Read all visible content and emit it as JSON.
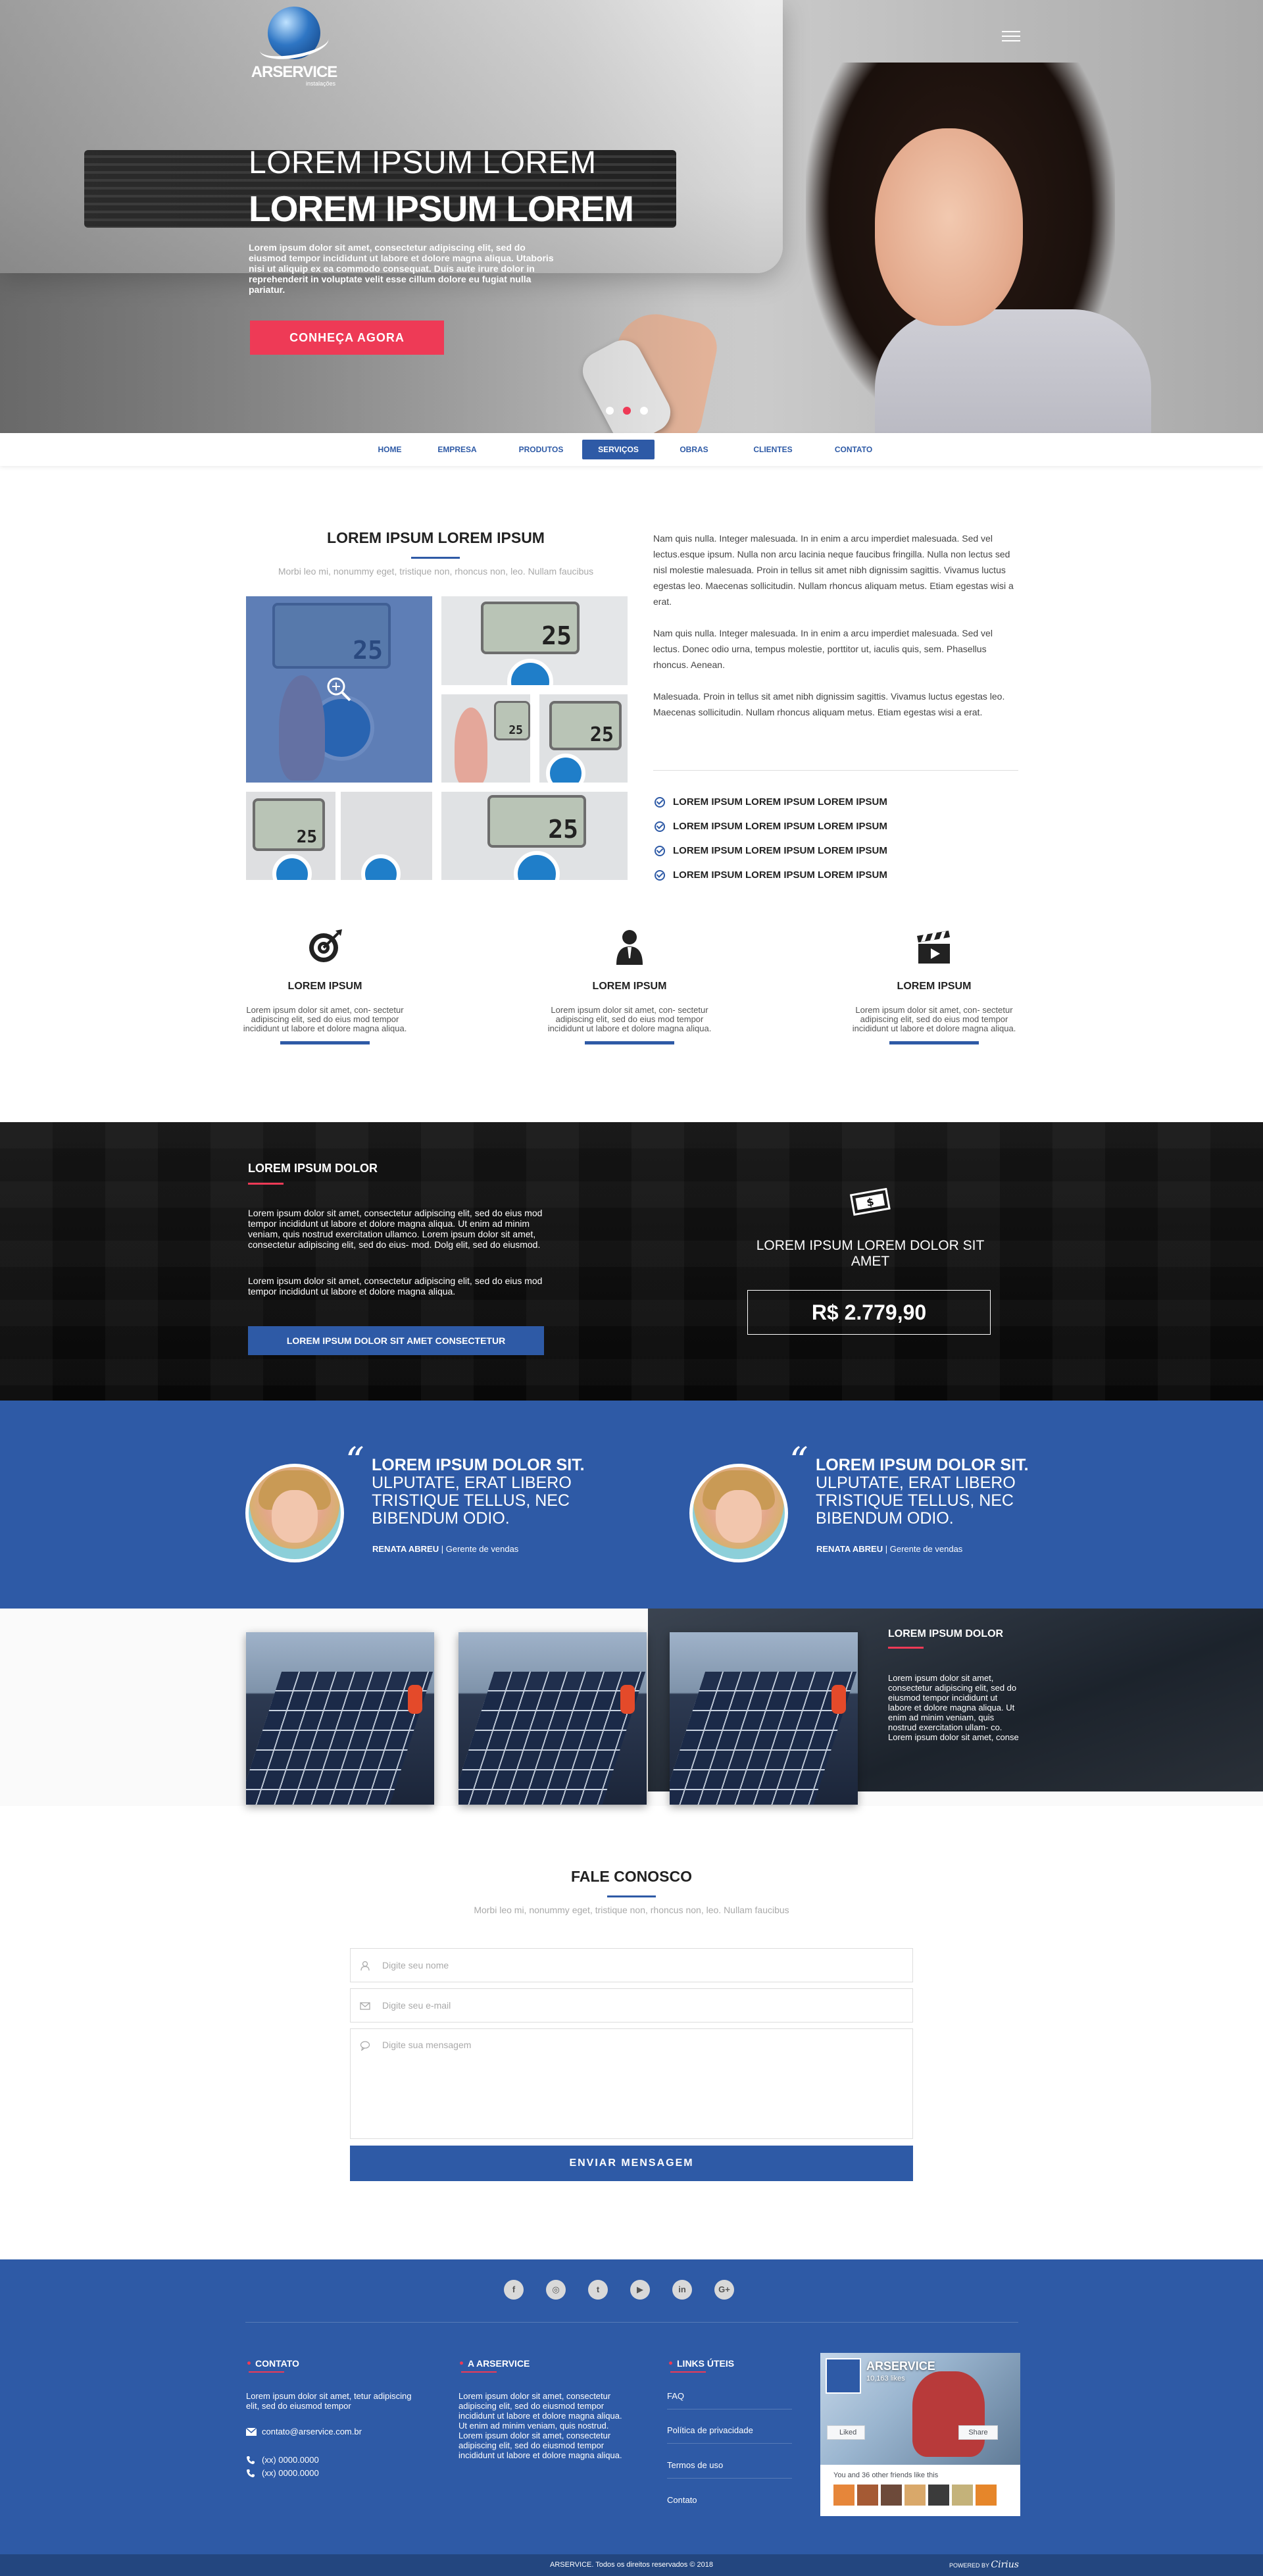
{
  "brand": {
    "name": "ARSERVICE",
    "tagline": "instalações"
  },
  "hero": {
    "line1": "LOREM IPSUM LOREM",
    "line2": "LOREM IPSUM LOREM",
    "paragraph": "Lorem ipsum dolor sit amet, consectetur adipiscing elit, sed do eiusmod tempor incididunt ut labore et dolore magna aliqua. Utaboris nisi ut aliquip ex ea commodo consequat. Duis aute irure dolor in reprehenderit in voluptate velit esse cillum dolore eu fugiat nulla pariatur.",
    "cta": "CONHEÇA AGORA",
    "slides": 3,
    "active_slide": 2
  },
  "nav": {
    "items": [
      "HOME",
      "EMPRESA",
      "PRODUTOS",
      "SERVIÇOS",
      "OBRAS",
      "CLIENTES",
      "CONTATO"
    ],
    "active": "SERVIÇOS"
  },
  "about": {
    "title": "LOREM IPSUM LOREM IPSUM",
    "subtitle": "Morbi leo mi, nonummy eget, tristique non, rhoncus non, leo. Nullam faucibus",
    "gallery_readouts": [
      "25",
      "25",
      "25",
      "25",
      "25",
      "25"
    ],
    "paragraphs": [
      "Nam quis nulla. Integer malesuada. In in enim a arcu imperdiet malesuada. Sed vel lectus.esque ipsum. Nulla non arcu lacinia neque faucibus fringilla. Nulla non lectus sed nisl molestie malesuada. Proin in tellus sit amet nibh dignissim sagittis. Vivamus luctus egestas leo. Maecenas sollicitudin. Nullam rhoncus aliquam metus. Etiam egestas wisi a erat.",
      "Nam quis nulla. Integer malesuada. In in enim a arcu imperdiet malesuada. Sed vel lectus. Donec odio urna, tempus molestie, porttitor ut, iaculis quis, sem. Phasellus rhoncus. Aenean.",
      "Malesuada. Proin in tellus sit amet nibh dignissim sagittis. Vivamus luctus egestas leo. Maecenas sollicitudin. Nullam rhoncus aliquam metus. Etiam egestas wisi a erat."
    ],
    "checklist": [
      "LOREM IPSUM LOREM IPSUM LOREM IPSUM",
      "LOREM IPSUM LOREM IPSUM LOREM IPSUM",
      "LOREM IPSUM LOREM IPSUM LOREM IPSUM",
      "LOREM IPSUM LOREM IPSUM LOREM IPSUM"
    ]
  },
  "features": [
    {
      "icon": "target-icon",
      "title": "LOREM IPSUM",
      "text": "Lorem ipsum dolor sit amet, con- sectetur adipiscing elit, sed do eius mod tempor incididunt ut labore et dolore magna aliqua."
    },
    {
      "icon": "businessman-icon",
      "title": "LOREM IPSUM",
      "text": "Lorem ipsum dolor sit amet, con- sectetur adipiscing elit, sed do eius mod tempor incididunt ut labore et dolore magna aliqua."
    },
    {
      "icon": "clapperboard-icon",
      "title": "LOREM IPSUM",
      "text": "Lorem ipsum dolor sit amet, con- sectetur adipiscing elit, sed do eius mod tempor incididunt ut labore et dolore magna aliqua."
    }
  ],
  "pricing": {
    "title": "LOREM IPSUM DOLOR",
    "p1": "Lorem ipsum dolor sit amet, consectetur adipiscing elit, sed do eius mod tempor incididunt ut labore et dolore magna aliqua. Ut enim ad minim veniam, quis nostrud exercitation ullamco. Lorem ipsum dolor sit amet, consectetur adipiscing elit, sed do eius- mod. Dolg elit, sed do eiusmod.",
    "p2": "Lorem ipsum dolor sit amet, consectetur adipiscing elit, sed do eius mod tempor incididunt ut labore et dolore magna aliqua.",
    "button": "LOREM IPSUM DOLOR SIT AMET CONSECTETUR",
    "price_title": "LOREM IPSUM LOREM DOLOR SIT AMET",
    "price": "R$ 2.779,90"
  },
  "testimonials": [
    {
      "quote_bold": "LOREM IPSUM DOLOR SIT.",
      "quote": "ULPUTATE, ERAT LIBERO TRISTIQUE TELLUS, NEC BIBENDUM ODIO.",
      "author": "RENATA ABREU",
      "role": "| Gerente de vendas"
    },
    {
      "quote_bold": "LOREM IPSUM DOLOR SIT.",
      "quote": "ULPUTATE, ERAT LIBERO TRISTIQUE TELLUS, NEC BIBENDUM ODIO.",
      "author": "RENATA ABREU",
      "role": "| Gerente de vendas"
    }
  ],
  "projects": {
    "title": "LOREM IPSUM DOLOR",
    "text": "Lorem ipsum dolor sit amet, consectetur adipiscing elit, sed do eiusmod tempor incididunt ut labore et dolore magna aliqua. Ut enim ad minim veniam, quis nostrud exercitation ullam- co. Lorem ipsum dolor sit amet, conse"
  },
  "contact": {
    "title": "FALE CONOSCO",
    "subtitle": "Morbi leo mi, nonummy eget, tristique non, rhoncus non, leo. Nullam faucibus",
    "name_placeholder": "Digite seu nome",
    "email_placeholder": "Digite seu e-mail",
    "message_placeholder": "Digite sua mensagem",
    "submit": "ENVIAR MENSAGEM"
  },
  "footer": {
    "social": [
      {
        "icon": "facebook-icon",
        "glyph": "f"
      },
      {
        "icon": "instagram-icon",
        "glyph": "◎"
      },
      {
        "icon": "twitter-icon",
        "glyph": "t"
      },
      {
        "icon": "youtube-icon",
        "glyph": "▶"
      },
      {
        "icon": "linkedin-icon",
        "glyph": "in"
      },
      {
        "icon": "google-plus-icon",
        "glyph": "G+"
      }
    ],
    "contato_title": "CONTATO",
    "contato_text": "Lorem ipsum dolor sit amet, tetur adipiscing elit, sed do eiusmod tempor",
    "email": "contato@arservice.com.br",
    "phone1": "(xx) 0000.0000",
    "phone2": "(xx) 0000.0000",
    "about_title": "A ARSERVICE",
    "about_text": "Lorem ipsum dolor sit amet, consectetur adipiscing elit, sed do eiusmod tempor incididunt ut labore et dolore magna aliqua. Ut enim ad minim veniam, quis nostrud. Lorem ipsum dolor sit amet, consectetur adipiscing elit, sed do eiusmod tempor incididunt ut labore et dolore magna aliqua.",
    "links_title": "LINKS ÚTEIS",
    "links": [
      "FAQ",
      "Política de privacidade",
      "Termos de uso",
      "Contato"
    ],
    "fb_name": "ARSERVICE",
    "fb_likes": "10,163 likes",
    "fb_liked": "Liked",
    "fb_share": "Share",
    "fb_friends": "You and 36 other friends like this",
    "copyright": "ARSERVICE. Todos os direitos reservados © 2018",
    "powered_label": "POWERED BY",
    "powered_brand": "Cirius"
  }
}
